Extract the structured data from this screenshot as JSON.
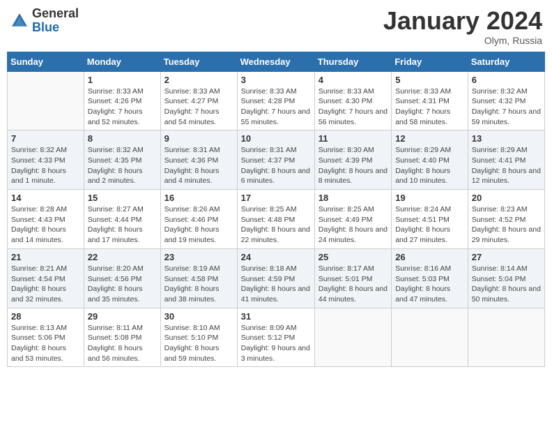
{
  "header": {
    "logo_general": "General",
    "logo_blue": "Blue",
    "month_title": "January 2024",
    "location": "Olym, Russia"
  },
  "weekdays": [
    "Sunday",
    "Monday",
    "Tuesday",
    "Wednesday",
    "Thursday",
    "Friday",
    "Saturday"
  ],
  "weeks": [
    [
      {
        "day": "",
        "sunrise": "",
        "sunset": "",
        "daylight": ""
      },
      {
        "day": "1",
        "sunrise": "Sunrise: 8:33 AM",
        "sunset": "Sunset: 4:26 PM",
        "daylight": "Daylight: 7 hours and 52 minutes."
      },
      {
        "day": "2",
        "sunrise": "Sunrise: 8:33 AM",
        "sunset": "Sunset: 4:27 PM",
        "daylight": "Daylight: 7 hours and 54 minutes."
      },
      {
        "day": "3",
        "sunrise": "Sunrise: 8:33 AM",
        "sunset": "Sunset: 4:28 PM",
        "daylight": "Daylight: 7 hours and 55 minutes."
      },
      {
        "day": "4",
        "sunrise": "Sunrise: 8:33 AM",
        "sunset": "Sunset: 4:30 PM",
        "daylight": "Daylight: 7 hours and 56 minutes."
      },
      {
        "day": "5",
        "sunrise": "Sunrise: 8:33 AM",
        "sunset": "Sunset: 4:31 PM",
        "daylight": "Daylight: 7 hours and 58 minutes."
      },
      {
        "day": "6",
        "sunrise": "Sunrise: 8:32 AM",
        "sunset": "Sunset: 4:32 PM",
        "daylight": "Daylight: 7 hours and 59 minutes."
      }
    ],
    [
      {
        "day": "7",
        "sunrise": "Sunrise: 8:32 AM",
        "sunset": "Sunset: 4:33 PM",
        "daylight": "Daylight: 8 hours and 1 minute."
      },
      {
        "day": "8",
        "sunrise": "Sunrise: 8:32 AM",
        "sunset": "Sunset: 4:35 PM",
        "daylight": "Daylight: 8 hours and 2 minutes."
      },
      {
        "day": "9",
        "sunrise": "Sunrise: 8:31 AM",
        "sunset": "Sunset: 4:36 PM",
        "daylight": "Daylight: 8 hours and 4 minutes."
      },
      {
        "day": "10",
        "sunrise": "Sunrise: 8:31 AM",
        "sunset": "Sunset: 4:37 PM",
        "daylight": "Daylight: 8 hours and 6 minutes."
      },
      {
        "day": "11",
        "sunrise": "Sunrise: 8:30 AM",
        "sunset": "Sunset: 4:39 PM",
        "daylight": "Daylight: 8 hours and 8 minutes."
      },
      {
        "day": "12",
        "sunrise": "Sunrise: 8:29 AM",
        "sunset": "Sunset: 4:40 PM",
        "daylight": "Daylight: 8 hours and 10 minutes."
      },
      {
        "day": "13",
        "sunrise": "Sunrise: 8:29 AM",
        "sunset": "Sunset: 4:41 PM",
        "daylight": "Daylight: 8 hours and 12 minutes."
      }
    ],
    [
      {
        "day": "14",
        "sunrise": "Sunrise: 8:28 AM",
        "sunset": "Sunset: 4:43 PM",
        "daylight": "Daylight: 8 hours and 14 minutes."
      },
      {
        "day": "15",
        "sunrise": "Sunrise: 8:27 AM",
        "sunset": "Sunset: 4:44 PM",
        "daylight": "Daylight: 8 hours and 17 minutes."
      },
      {
        "day": "16",
        "sunrise": "Sunrise: 8:26 AM",
        "sunset": "Sunset: 4:46 PM",
        "daylight": "Daylight: 8 hours and 19 minutes."
      },
      {
        "day": "17",
        "sunrise": "Sunrise: 8:25 AM",
        "sunset": "Sunset: 4:48 PM",
        "daylight": "Daylight: 8 hours and 22 minutes."
      },
      {
        "day": "18",
        "sunrise": "Sunrise: 8:25 AM",
        "sunset": "Sunset: 4:49 PM",
        "daylight": "Daylight: 8 hours and 24 minutes."
      },
      {
        "day": "19",
        "sunrise": "Sunrise: 8:24 AM",
        "sunset": "Sunset: 4:51 PM",
        "daylight": "Daylight: 8 hours and 27 minutes."
      },
      {
        "day": "20",
        "sunrise": "Sunrise: 8:23 AM",
        "sunset": "Sunset: 4:52 PM",
        "daylight": "Daylight: 8 hours and 29 minutes."
      }
    ],
    [
      {
        "day": "21",
        "sunrise": "Sunrise: 8:21 AM",
        "sunset": "Sunset: 4:54 PM",
        "daylight": "Daylight: 8 hours and 32 minutes."
      },
      {
        "day": "22",
        "sunrise": "Sunrise: 8:20 AM",
        "sunset": "Sunset: 4:56 PM",
        "daylight": "Daylight: 8 hours and 35 minutes."
      },
      {
        "day": "23",
        "sunrise": "Sunrise: 8:19 AM",
        "sunset": "Sunset: 4:58 PM",
        "daylight": "Daylight: 8 hours and 38 minutes."
      },
      {
        "day": "24",
        "sunrise": "Sunrise: 8:18 AM",
        "sunset": "Sunset: 4:59 PM",
        "daylight": "Daylight: 8 hours and 41 minutes."
      },
      {
        "day": "25",
        "sunrise": "Sunrise: 8:17 AM",
        "sunset": "Sunset: 5:01 PM",
        "daylight": "Daylight: 8 hours and 44 minutes."
      },
      {
        "day": "26",
        "sunrise": "Sunrise: 8:16 AM",
        "sunset": "Sunset: 5:03 PM",
        "daylight": "Daylight: 8 hours and 47 minutes."
      },
      {
        "day": "27",
        "sunrise": "Sunrise: 8:14 AM",
        "sunset": "Sunset: 5:04 PM",
        "daylight": "Daylight: 8 hours and 50 minutes."
      }
    ],
    [
      {
        "day": "28",
        "sunrise": "Sunrise: 8:13 AM",
        "sunset": "Sunset: 5:06 PM",
        "daylight": "Daylight: 8 hours and 53 minutes."
      },
      {
        "day": "29",
        "sunrise": "Sunrise: 8:11 AM",
        "sunset": "Sunset: 5:08 PM",
        "daylight": "Daylight: 8 hours and 56 minutes."
      },
      {
        "day": "30",
        "sunrise": "Sunrise: 8:10 AM",
        "sunset": "Sunset: 5:10 PM",
        "daylight": "Daylight: 8 hours and 59 minutes."
      },
      {
        "day": "31",
        "sunrise": "Sunrise: 8:09 AM",
        "sunset": "Sunset: 5:12 PM",
        "daylight": "Daylight: 9 hours and 3 minutes."
      },
      {
        "day": "",
        "sunrise": "",
        "sunset": "",
        "daylight": ""
      },
      {
        "day": "",
        "sunrise": "",
        "sunset": "",
        "daylight": ""
      },
      {
        "day": "",
        "sunrise": "",
        "sunset": "",
        "daylight": ""
      }
    ]
  ]
}
